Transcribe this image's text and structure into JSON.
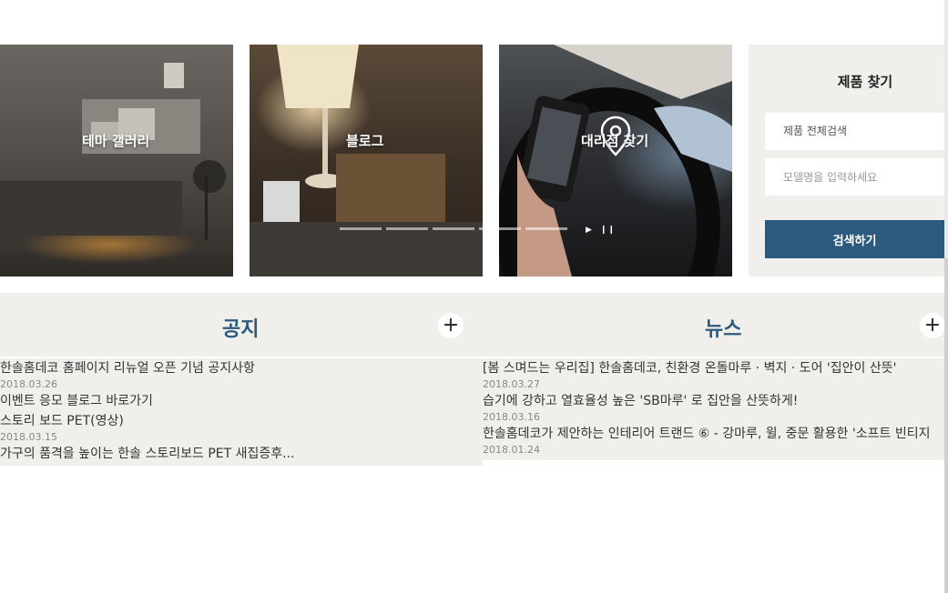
{
  "cards": {
    "gallery": {
      "label": "테마 갤러리"
    },
    "blog": {
      "label": "블로그"
    },
    "dealer": {
      "label": "대리점 찾기",
      "icon": "map-pin-icon"
    }
  },
  "slider": {
    "count": 5,
    "play_icon": "play-icon",
    "pause_icon": "pause-icon"
  },
  "search": {
    "title": "제품 찾기",
    "category": "제품 전체검색",
    "placeholder": "모델명을 입력하세요",
    "button": "검색하기"
  },
  "notice": {
    "title": "공지",
    "items": [
      {
        "title": "한솔홈데코 홈페이지 리뉴얼 오픈 기념 공지사항",
        "date": "2018.03.26"
      },
      {
        "title": "이벤트 응모 블로그 바로가기",
        "date": ""
      },
      {
        "title": "스토리 보드 PET(영상)",
        "date": "2018.03.15"
      },
      {
        "title": "가구의 품격을 높이는 한솔 스토리보드 PET 새집증후...",
        "date": ""
      }
    ]
  },
  "news": {
    "title": "뉴스",
    "items": [
      {
        "title": "[봄 스며드는 우리집] 한솔홈데코, 친환경 온돌마루 · 벽지 · 도어 '집안이 산뜻'",
        "date": "2018.03.27"
      },
      {
        "title": "습기에 강하고 열효율성 높은 'SB마루' 로 집안을 산뜻하게!",
        "date": "2018.03.16"
      },
      {
        "title": "한솔홈데코가 제안하는 인테리어 트랜드 ⑥ - 강마루, 윌, 중문 활용한 '소프트 빈티지",
        "date": "2018.01.24"
      }
    ]
  },
  "colors": {
    "accent": "#2c5a7e",
    "panel": "#f1efec"
  }
}
